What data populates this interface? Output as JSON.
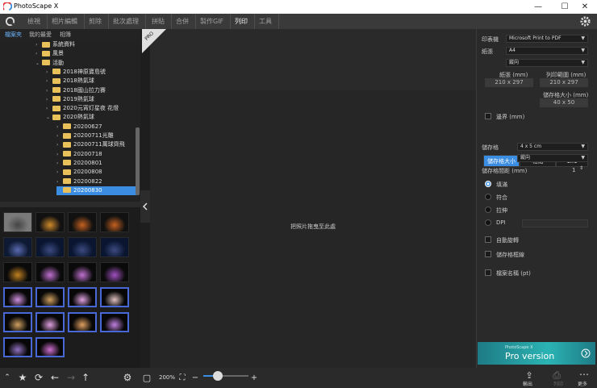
{
  "window": {
    "title": "PhotoScape X",
    "controls": [
      "—",
      "☐",
      "✕"
    ]
  },
  "menu": {
    "tabs": [
      "檢視",
      "相片編輯",
      "剪除",
      "批次處理",
      "拼貼",
      "合併",
      "製作GIF",
      "列印",
      "工具"
    ],
    "active": "列印"
  },
  "left": {
    "tabs": [
      "檔案夾",
      "我的最愛",
      "相簿"
    ],
    "tree": [
      {
        "label": "系統資料",
        "depth": 3,
        "arrow": ">"
      },
      {
        "label": "風景",
        "depth": 3,
        "arrow": ">"
      },
      {
        "label": "活動",
        "depth": 3,
        "arrow": "v"
      },
      {
        "label": "2018神原寶島號",
        "depth": 4,
        "arrow": ">"
      },
      {
        "label": "2018熱氣球",
        "depth": 4,
        "arrow": ">"
      },
      {
        "label": "2018國山拉力賽",
        "depth": 4,
        "arrow": ">"
      },
      {
        "label": "2019熱氣球",
        "depth": 4,
        "arrow": ">"
      },
      {
        "label": "2020元宵灯星夜 花燈",
        "depth": 4,
        "arrow": ">"
      },
      {
        "label": "2020熱氣球",
        "depth": 4,
        "arrow": "v"
      },
      {
        "label": "20200627",
        "depth": 5,
        "arrow": ">"
      },
      {
        "label": "20200711光雕",
        "depth": 5,
        "arrow": ">"
      },
      {
        "label": "20200711萬球齊飛",
        "depth": 5,
        "arrow": ">"
      },
      {
        "label": "20200718",
        "depth": 5,
        "arrow": ">"
      },
      {
        "label": "20200801",
        "depth": 5,
        "arrow": ">"
      },
      {
        "label": "20200808",
        "depth": 5,
        "arrow": ">"
      },
      {
        "label": "20200822",
        "depth": 5,
        "arrow": ">"
      },
      {
        "label": "20200830",
        "depth": 5,
        "arrow": "",
        "selected": true
      }
    ]
  },
  "center": {
    "drop_text": "把照片拖曳至此處"
  },
  "right": {
    "printer_label": "印表機",
    "printer_value": "Microsoft Print to PDF",
    "paper_label": "紙張",
    "paper_value": "A4",
    "orientation_value": "縱向",
    "paper_size_label": "紙張 (mm)",
    "paper_size_value": "210 x 297",
    "printable_label": "列印範圍 (mm)",
    "printable_value": "210 x 297",
    "storage_size_label": "儲存格大小 (mm)",
    "storage_size_value": "40 x 50",
    "margin_label": "邊界 (mm)",
    "seg": [
      "儲存格大小",
      "相點",
      "1x1"
    ],
    "cell_label": "儲存格",
    "cell_value": "4 x 5 cm",
    "cell_orient": "縱向",
    "spacing_label": "儲存格間距 (mm)",
    "spacing_value": "1",
    "fit": [
      "填滿",
      "符合",
      "拉伸",
      "DPI"
    ],
    "checks": [
      "自動旋轉",
      "儲存格框線",
      "檔案名稱 (pt)"
    ],
    "banner_small": "PhotoScape X",
    "banner_big": "Pro version"
  },
  "bottom": {
    "zoom": "200%",
    "zoom_fraction": 0.33,
    "actions": [
      "輸出",
      "列印",
      "更多"
    ]
  }
}
